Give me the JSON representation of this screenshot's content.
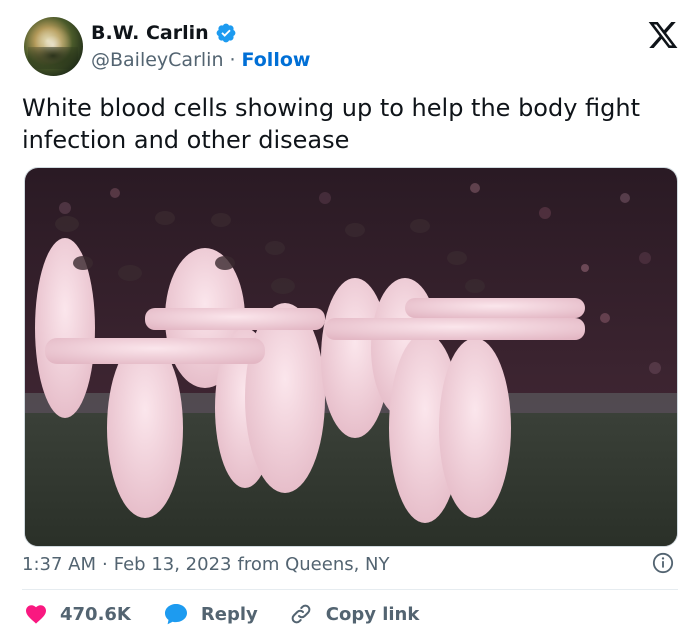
{
  "author": {
    "display_name": "B.W. Carlin",
    "handle": "@BaileyCarlin",
    "separator": "·",
    "follow_label": "Follow"
  },
  "tweet": {
    "text": "White blood cells showing up to help the body fight infection and other disease"
  },
  "meta": {
    "time": "1:37 AM",
    "separator": "·",
    "date": "Feb 13, 2023",
    "location": "from Queens, NY"
  },
  "actions": {
    "likes_count": "470.6K",
    "reply_label": "Reply",
    "copy_link_label": "Copy link"
  },
  "colors": {
    "like": "#f91880",
    "reply": "#1d9bf0",
    "link": "#006fd6",
    "verified": "#1d9bf0",
    "secondary_text": "#536471"
  },
  "icons": {
    "verified": "verified-badge-icon",
    "brand": "x-logo-icon",
    "info": "info-icon",
    "like": "heart-icon",
    "reply": "speech-bubble-icon",
    "copy_link": "link-icon"
  }
}
